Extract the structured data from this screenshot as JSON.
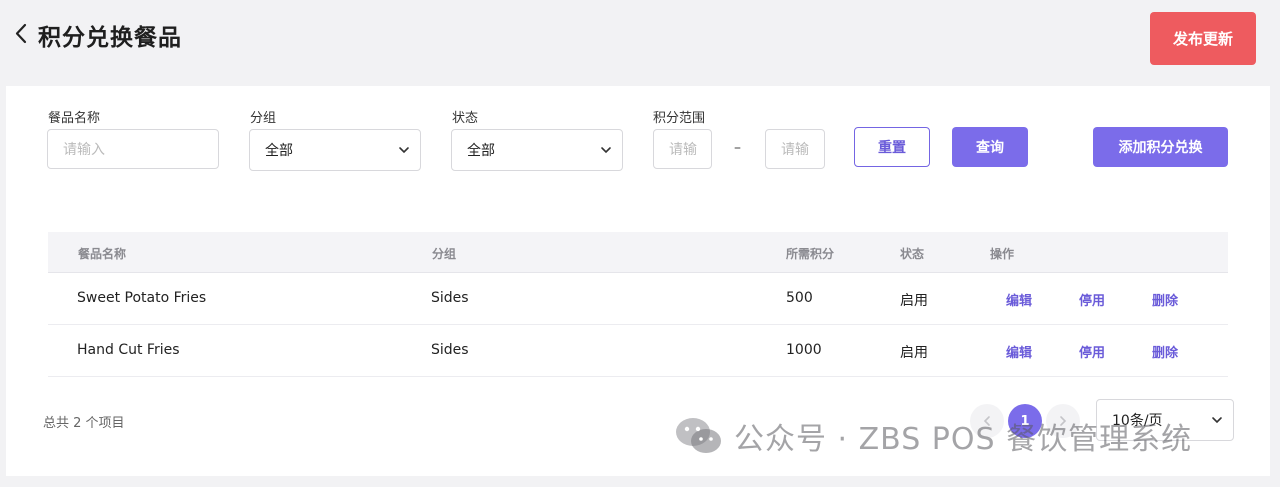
{
  "header": {
    "title": "积分兑换餐品",
    "publish_label": "发布更新"
  },
  "filters": {
    "name_label": "餐品名称",
    "name_placeholder": "请输入",
    "group_label": "分组",
    "group_value": "全部",
    "status_label": "状态",
    "status_value": "全部",
    "points_label": "积分范围",
    "points_min_placeholder": "请输",
    "points_max_placeholder": "请输",
    "range_separator": "–",
    "reset_label": "重置",
    "query_label": "查询",
    "add_label": "添加积分兑换"
  },
  "table": {
    "columns": [
      "餐品名称",
      "分组",
      "所需积分",
      "状态",
      "操作"
    ],
    "rows": [
      {
        "name": "Sweet Potato Fries",
        "group": "Sides",
        "points": "500",
        "status": "启用",
        "edit": "编辑",
        "disable": "停用",
        "delete": "删除"
      },
      {
        "name": "Hand Cut Fries",
        "group": "Sides",
        "points": "1000",
        "status": "启用",
        "edit": "编辑",
        "disable": "停用",
        "delete": "删除"
      }
    ]
  },
  "pagination": {
    "total_text": "总共 2 个项目",
    "current_page": "1",
    "page_size": "10条/页"
  },
  "watermark": {
    "text": "公众号 · ZBS POS 餐饮管理系统"
  },
  "colors": {
    "accent": "#7b6cea",
    "publish": "#ee5b5f",
    "background": "#f2f2f4"
  }
}
